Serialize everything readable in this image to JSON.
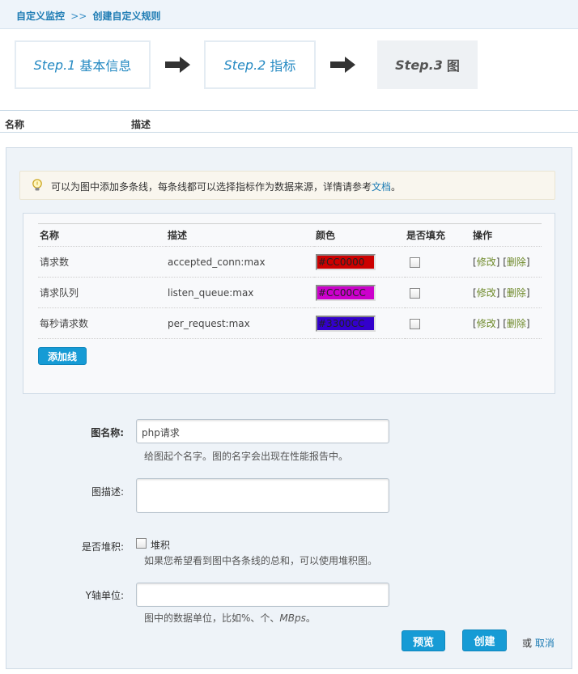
{
  "breadcrumb": {
    "parent": "自定义监控",
    "separator": ">>",
    "current": "创建自定义规则"
  },
  "steps": [
    {
      "prefix": "Step.1",
      "label": "基本信息"
    },
    {
      "prefix": "Step.2",
      "label": "指标"
    },
    {
      "prefix": "Step.3",
      "label": "图"
    }
  ],
  "list_header": {
    "name": "名称",
    "desc": "描述"
  },
  "tip": {
    "text": "可以为图中添加多条线，每条线都可以选择指标作为数据来源，详情请参考",
    "link": "文档",
    "end": "。"
  },
  "lines_table": {
    "headers": [
      "名称",
      "描述",
      "颜色",
      "是否填充",
      "操作"
    ],
    "rows": [
      {
        "name": "请求数",
        "desc": "accepted_conn:max",
        "color": "#CC0000",
        "swatch_color": "#CC0000"
      },
      {
        "name": "请求队列",
        "desc": "listen_queue:max",
        "color": "#CC00CC",
        "swatch_color": "#CC00CC"
      },
      {
        "name": "每秒请求数",
        "desc": "per_request:max",
        "color": "#3300CC",
        "swatch_color": "#3300CC"
      }
    ],
    "edit_label": "修改",
    "delete_label": "删除",
    "add_button": "添加线"
  },
  "form": {
    "graph_name_label": "图名称:",
    "graph_name_value": "php请求",
    "graph_name_hint": "给图起个名字。图的名字会出现在性能报告中。",
    "graph_desc_label": "图描述:",
    "graph_desc_value": "",
    "stack_label": "是否堆积:",
    "stack_checkbox_label": "堆积",
    "stack_hint": "如果您希望看到图中各条线的总和，可以使用堆积图。",
    "y_unit_label": "Y轴单位:",
    "y_unit_value": "",
    "y_unit_hint_prefix": "图中的数据单位，比如%、个、",
    "y_unit_hint_italic": "MBps",
    "y_unit_hint_suffix": "。"
  },
  "actions": {
    "preview": "预览",
    "create": "创建",
    "or": "或",
    "cancel": "取消"
  },
  "colors": {
    "accent": "#169bd5",
    "link": "#1e7cb4"
  }
}
